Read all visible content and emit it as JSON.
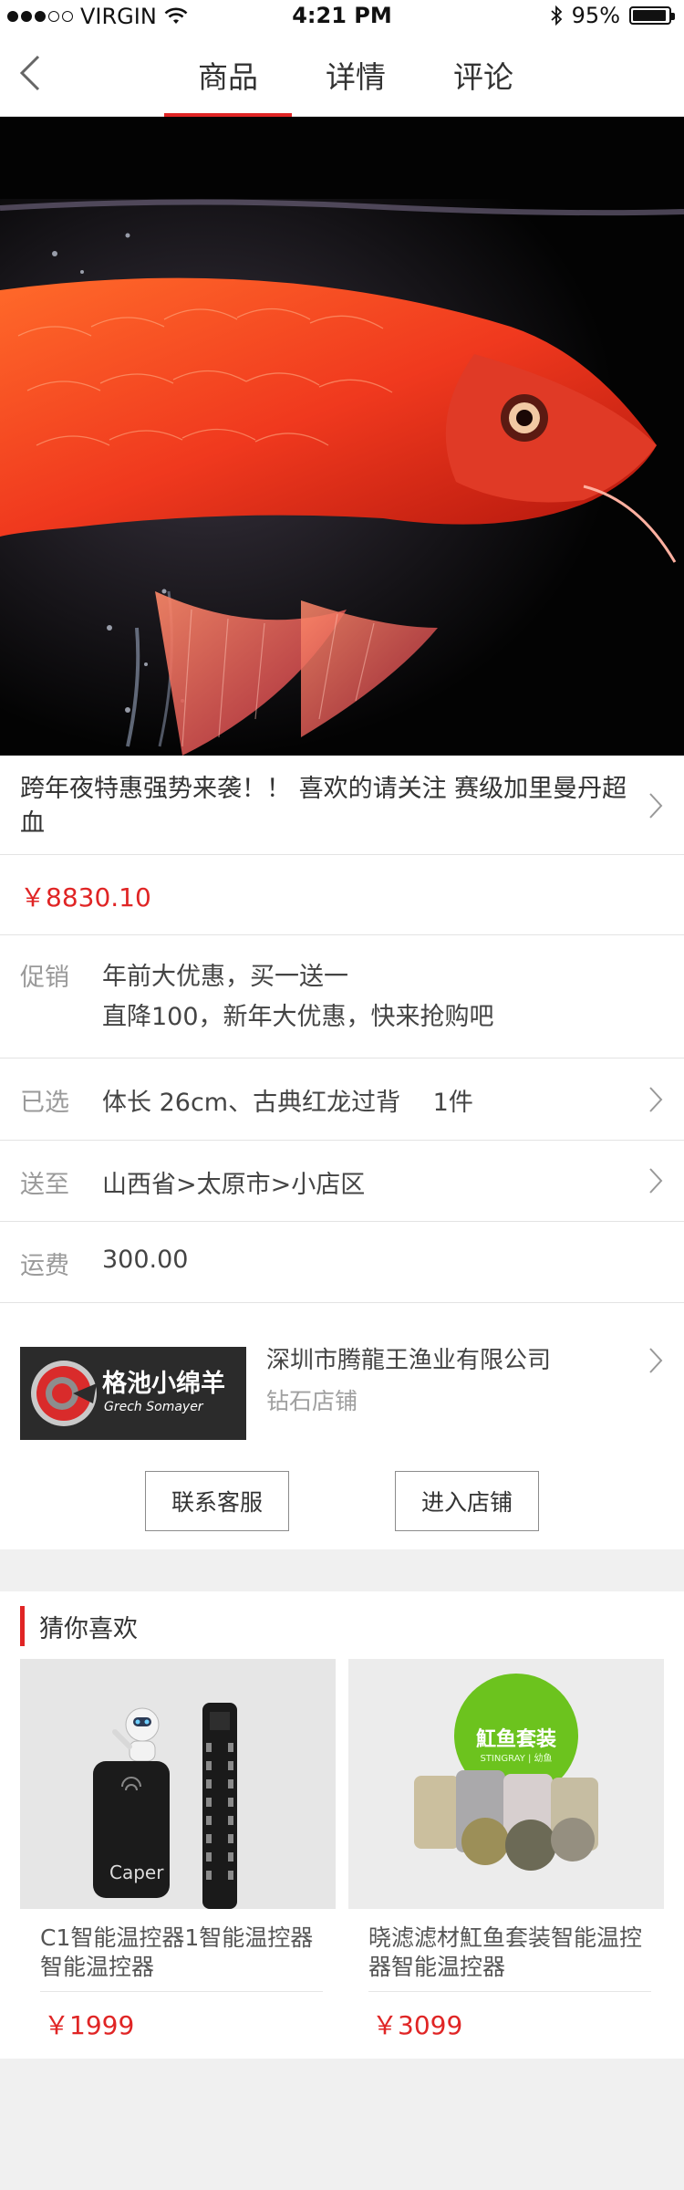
{
  "status": {
    "carrier": "VIRGIN",
    "time": "4:21 PM",
    "battery": "95%",
    "battery_level": 0.95
  },
  "nav": {
    "tabs": [
      "商品",
      "详情",
      "评论"
    ],
    "active_tab": 0
  },
  "product": {
    "title": "跨年夜特惠强势来袭！！ 喜欢的请关注 赛级加里曼丹超血",
    "price": "￥8830.10",
    "promo_label": "促销",
    "promo_lines": [
      "年前大优惠，买一送一",
      "直降100，新年大优惠，快来抢购吧"
    ],
    "selected_label": "已选",
    "selected_value": "体长 26cm、古典红龙过背　 1件",
    "deliver_label": "送至",
    "deliver_value": "山西省>太原市>小店区",
    "shipping_label": "运费",
    "shipping_value": "300.00"
  },
  "shop": {
    "logo_text_cn": "格池小绵羊",
    "logo_text_en": "Grech Somayer",
    "name": "深圳市腾龍王渔业有限公司",
    "level": "钻石店铺",
    "contact_button": "联系客服",
    "enter_button": "进入店铺"
  },
  "recommend": {
    "title": "猜你喜欢",
    "items": [
      {
        "name": "C1智能温控器1智能温控器智能温控器",
        "price": "￥1999",
        "brand_text": "Caper"
      },
      {
        "name": "晓滤滤材魟鱼套装智能温控器智能温控器",
        "price": "￥3099",
        "badge_text": "魟鱼套装",
        "badge_sub": "STINGRAY | 幼鱼"
      }
    ]
  },
  "colors": {
    "accent": "#e02525",
    "text": "#333333",
    "muted": "#9a9a9a",
    "background": "#f0f0f0"
  }
}
